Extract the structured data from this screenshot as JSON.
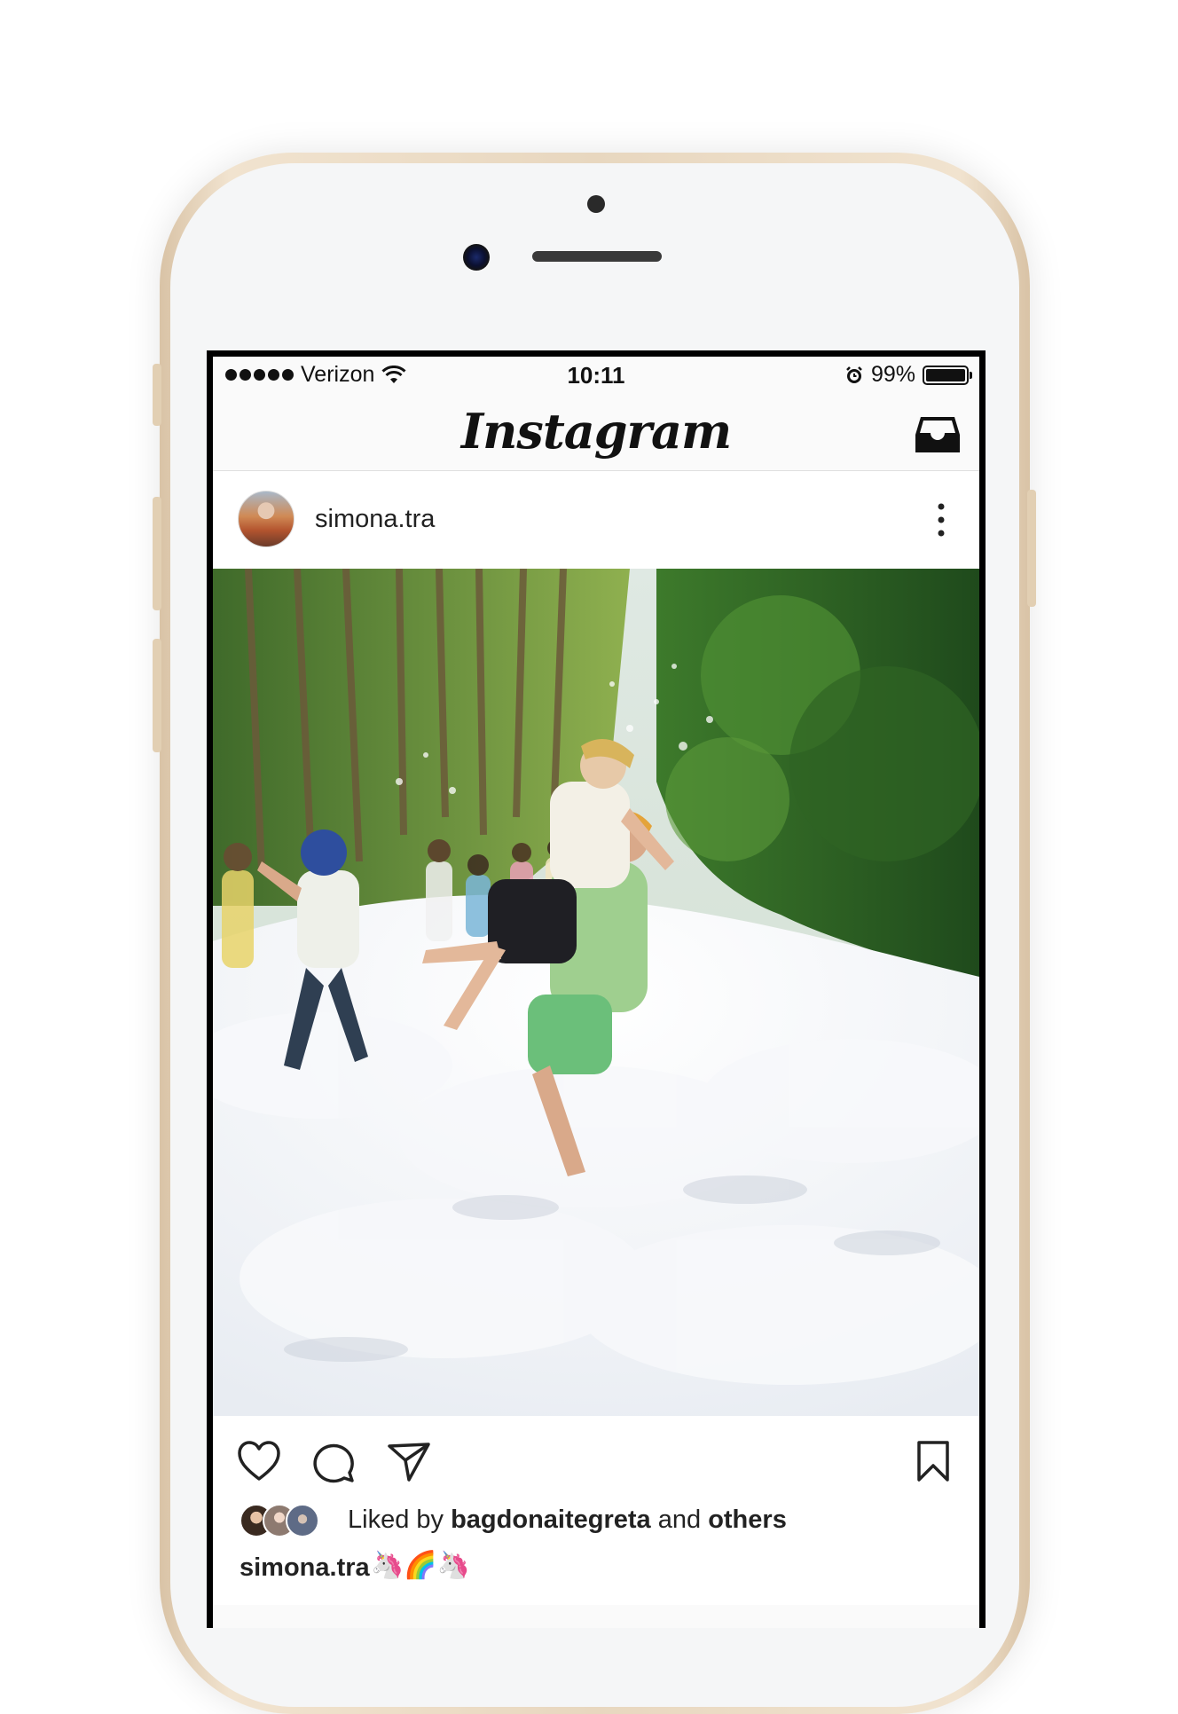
{
  "status_bar": {
    "signal": "●●●●●",
    "carrier": "Verizon",
    "wifi_icon": "wifi-icon",
    "time": "10:11",
    "alarm_icon": "alarm-icon",
    "battery_percent_text": "99%",
    "battery_level": 0.99
  },
  "nav": {
    "logo": "Instagram",
    "inbox_icon": "inbox-icon"
  },
  "post": {
    "username": "simona.tra",
    "more_icon": "more-vertical-icon",
    "photo_description_icon": "photo",
    "actions": {
      "like_icon": "heart-icon",
      "comment_icon": "comment-icon",
      "share_icon": "send-icon",
      "bookmark_icon": "bookmark-icon"
    },
    "likes": {
      "prefix": "Liked by",
      "user": "bagdonaitegreta",
      "middle": "and",
      "suffix": "others"
    },
    "caption": {
      "user": "simona.tra",
      "text": "🦄🌈🦄"
    }
  },
  "colors": {
    "frame_gold": "#e8d7bf",
    "screen_bg": "#fafafa",
    "text": "#222222"
  }
}
